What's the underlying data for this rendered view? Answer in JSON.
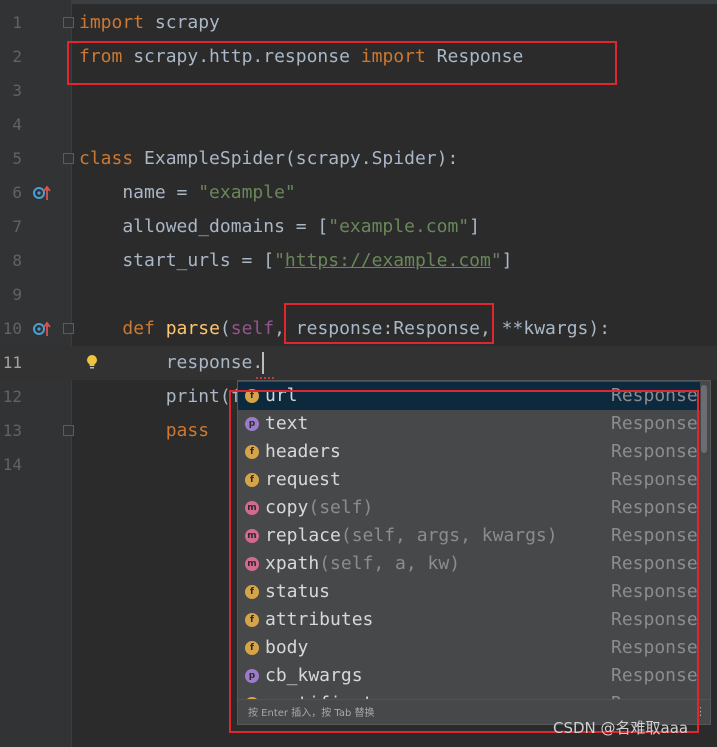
{
  "editor": {
    "line_numbers": [
      "1",
      "2",
      "3",
      "4",
      "5",
      "6",
      "7",
      "8",
      "9",
      "10",
      "11",
      "12",
      "13",
      "14"
    ],
    "lines": {
      "l1": {
        "kw": "import",
        "rest": " scrapy"
      },
      "l2": {
        "kw1": "from",
        "mod": " scrapy.http.response ",
        "kw2": "import",
        "rest": " Response"
      },
      "l5": {
        "kw": "class",
        "rest": " ExampleSpider(scrapy.Spider):"
      },
      "l6": {
        "lhs": "    name = ",
        "str": "\"example\""
      },
      "l7": {
        "lhs": "    allowed_domains = [",
        "str": "\"example.com\"",
        "end": "]"
      },
      "l8": {
        "lhs": "    start_urls = [",
        "q1": "\"",
        "url": "https://example.com",
        "q2": "\"",
        "end": "]"
      },
      "l10": {
        "indent": "    ",
        "kw": "def",
        "sp": " ",
        "fn": "parse",
        "p1": "(",
        "self": "self",
        "rest": ", response:Response, **kwargs):"
      },
      "l11": {
        "text": "        response."
      },
      "l12": {
        "text": "        print(f"
      },
      "l13": {
        "text": "        pass"
      }
    }
  },
  "completion": {
    "items": [
      {
        "name": "url",
        "params": "",
        "type": "Response",
        "kind": "f",
        "color": "#d6a448"
      },
      {
        "name": "text",
        "params": "",
        "type": "Response",
        "kind": "p",
        "color": "#9b7cc8"
      },
      {
        "name": "headers",
        "params": "",
        "type": "Response",
        "kind": "f",
        "color": "#d6a448"
      },
      {
        "name": "request",
        "params": "",
        "type": "Response",
        "kind": "f",
        "color": "#d6a448"
      },
      {
        "name": "copy",
        "params": "(self)",
        "type": "Response",
        "kind": "m",
        "color": "#d26a8e"
      },
      {
        "name": "replace",
        "params": "(self, args, kwargs)",
        "type": "Response",
        "kind": "m",
        "color": "#d26a8e"
      },
      {
        "name": "xpath",
        "params": "(self, a, kw)",
        "type": "Response",
        "kind": "m",
        "color": "#d26a8e"
      },
      {
        "name": "status",
        "params": "",
        "type": "Response",
        "kind": "f",
        "color": "#d6a448"
      },
      {
        "name": "attributes",
        "params": "",
        "type": "Response",
        "kind": "f",
        "color": "#d6a448"
      },
      {
        "name": "body",
        "params": "",
        "type": "Response",
        "kind": "f",
        "color": "#d6a448"
      },
      {
        "name": "cb_kwargs",
        "params": "",
        "type": "Response",
        "kind": "p",
        "color": "#9b7cc8"
      },
      {
        "name": "certificate",
        "params": "",
        "type": "Response",
        "kind": "f",
        "color": "#d6a448"
      }
    ],
    "footer_hint": "按 Enter 插入，按 Tab 替换",
    "footer_more": "⋮"
  },
  "watermark": "CSDN @名难取aaa",
  "icons": {
    "override": "override-icon",
    "bulb": "lightbulb-icon",
    "fold": "fold-icon"
  },
  "colors": {
    "keyword": "#cc7832",
    "string": "#6a8759",
    "function": "#ffc66d",
    "self": "#94558d",
    "highlight_box": "#e0262e",
    "selected_item": "#0d293e"
  }
}
